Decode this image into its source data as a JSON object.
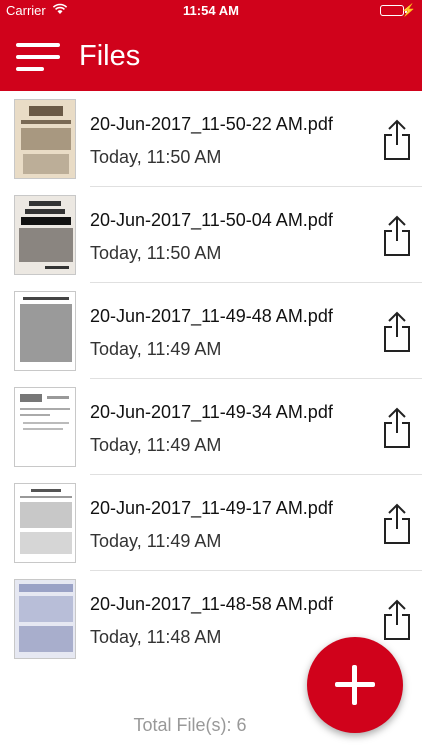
{
  "status_bar": {
    "carrier": "Carrier",
    "time": "11:54 AM",
    "battery_level": 1.0
  },
  "navbar": {
    "title": "Files",
    "menu_icon": "hamburger-menu-icon"
  },
  "files": [
    {
      "name": "20-Jun-2017_11-50-22 AM.pdf",
      "date": "Today, 11:50 AM"
    },
    {
      "name": "20-Jun-2017_11-50-04 AM.pdf",
      "date": "Today, 11:50 AM"
    },
    {
      "name": "20-Jun-2017_11-49-48 AM.pdf",
      "date": "Today, 11:49 AM"
    },
    {
      "name": "20-Jun-2017_11-49-34 AM.pdf",
      "date": "Today, 11:49 AM"
    },
    {
      "name": "20-Jun-2017_11-49-17 AM.pdf",
      "date": "Today, 11:49 AM"
    },
    {
      "name": "20-Jun-2017_11-48-58 AM.pdf",
      "date": "Today, 11:48 AM"
    }
  ],
  "share_icon": "share-icon",
  "total_label": "Total File(s): 6",
  "fab_icon": "plus-icon",
  "colors": {
    "brand": "#d0021b",
    "battery": "#4cd964"
  }
}
